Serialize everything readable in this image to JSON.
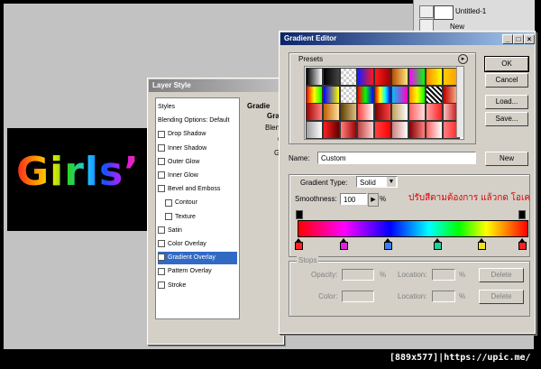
{
  "artwork": {
    "text": "Girls’"
  },
  "layers_panel": {
    "item_1": "Untitled-1",
    "item_2": "New"
  },
  "layer_style": {
    "title": "Layer Style",
    "items": [
      {
        "label": "Styles",
        "check": false,
        "checked": false
      },
      {
        "label": "Blending Options: Default",
        "check": false,
        "checked": false
      },
      {
        "label": "Drop Shadow",
        "check": true,
        "checked": false
      },
      {
        "label": "Inner Shadow",
        "check": true,
        "checked": false
      },
      {
        "label": "Outer Glow",
        "check": true,
        "checked": false
      },
      {
        "label": "Inner Glow",
        "check": true,
        "checked": false
      },
      {
        "label": "Bevel and Emboss",
        "check": true,
        "checked": false
      },
      {
        "label": "Contour",
        "check": true,
        "checked": false,
        "indent": true
      },
      {
        "label": "Texture",
        "check": true,
        "checked": false,
        "indent": true
      },
      {
        "label": "Satin",
        "check": true,
        "checked": false
      },
      {
        "label": "Color Overlay",
        "check": true,
        "checked": false
      },
      {
        "label": "Gradient Overlay",
        "check": true,
        "checked": true,
        "selected": true
      },
      {
        "label": "Pattern Overlay",
        "check": true,
        "checked": false
      },
      {
        "label": "Stroke",
        "check": true,
        "checked": false
      }
    ],
    "group_label_1": "Gradie",
    "group_label_2": "Grad",
    "labels": [
      "Blend",
      "O",
      "G"
    ]
  },
  "gradient_editor": {
    "title": "Gradient Editor",
    "presets_label": "Presets",
    "ok": "OK",
    "cancel": "Cancel",
    "load": "Load...",
    "save": "Save...",
    "name_label": "Name:",
    "name_value": "Custom",
    "new": "New",
    "gradient_type_label": "Gradient Type:",
    "gradient_type_value": "Solid",
    "smoothness_label": "Smoothness:",
    "smoothness_value": "100",
    "percent": "%",
    "annotation": "ปรับสีตามต้องการ แล้วกด โอเค",
    "stops_label": "Stops",
    "opacity_label": "Opacity:",
    "color_label": "Color:",
    "location_label": "Location:",
    "delete": "Delete",
    "stop_colors": [
      "#ff2020",
      "#e020e0",
      "#3a7dff",
      "#20d0a0",
      "#f0e020",
      "#ff2020"
    ]
  },
  "watermark": "[889x577]|https://upic.me/"
}
